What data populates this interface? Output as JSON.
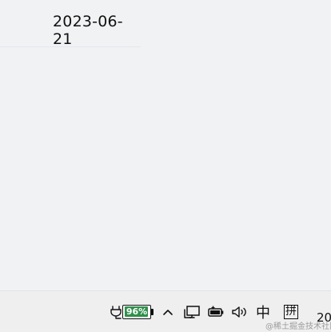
{
  "header": {
    "date": "2023-06-21"
  },
  "taskbar": {
    "battery_percent_text": "96%",
    "battery_level": 0.96,
    "ime_mode": "中",
    "ime_layout": "拼",
    "clock_text": "20"
  },
  "watermark": "@稀土掘金技术社区",
  "icons": {
    "plug": "plug-icon",
    "chevron": "chevron-up-icon",
    "network": "network-icon",
    "battery2": "battery-icon",
    "volume": "volume-icon"
  },
  "colors": {
    "battery_fill": "#2f8f4b",
    "page_bg": "#f1f2f4",
    "taskbar_bg": "#efefef"
  }
}
